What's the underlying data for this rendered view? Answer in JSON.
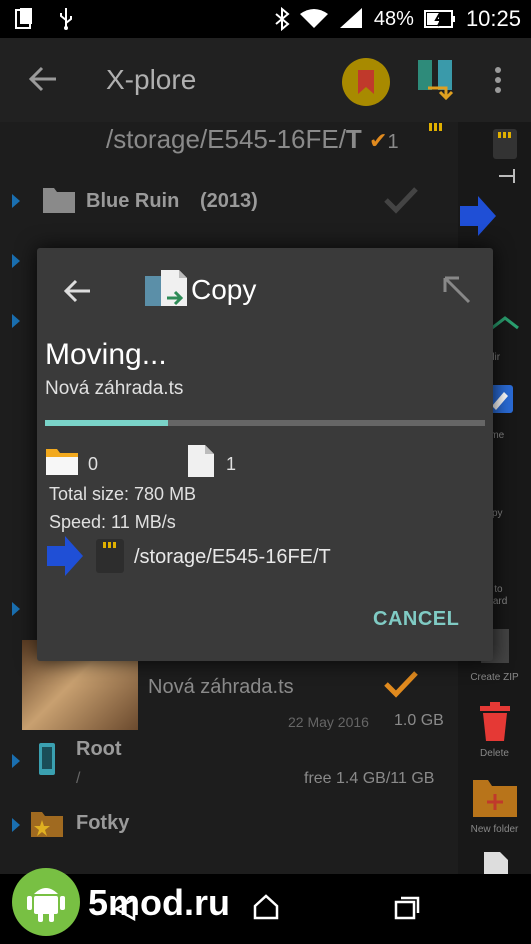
{
  "status_bar": {
    "battery": "48%",
    "time": "10:25"
  },
  "app_bar": {
    "title": "X-plore"
  },
  "pane": {
    "path": "/storage/E545-16FE/",
    "path_bold": "T",
    "marked_count": "1",
    "rows": [
      {
        "name": "Blue Ruin",
        "year": "(2013)"
      },
      {
        "name": "Nová záhrada.ts",
        "date": "22 May 2016",
        "size": "1.0 GB"
      },
      {
        "name": "Root",
        "sub": "/",
        "free": "free 1.4 GB/11 GB"
      },
      {
        "name": "Fotky"
      }
    ]
  },
  "right_toolbar": {
    "labels": [
      "dir",
      "ame",
      "opy",
      "y to",
      "board",
      "Create ZIP",
      "Delete",
      "New folder"
    ]
  },
  "dialog": {
    "title": "Copy",
    "heading": "Moving...",
    "file_name": "Nová záhrada.ts",
    "progress": 0.28,
    "folder_count": "0",
    "file_count": "1",
    "total_size": "Total size: 780 MB",
    "speed": "Speed: 11 MB/s",
    "destination": "/storage/E545-16FE/T",
    "cancel_label": "CANCEL"
  },
  "watermark": {
    "text": "5mod.ru"
  },
  "colors": {
    "accent": "#80cbc4",
    "progress_fill": "#7ad3c8",
    "arrow_blue": "#1f4fd6",
    "check_orange": "#e08a1e"
  }
}
